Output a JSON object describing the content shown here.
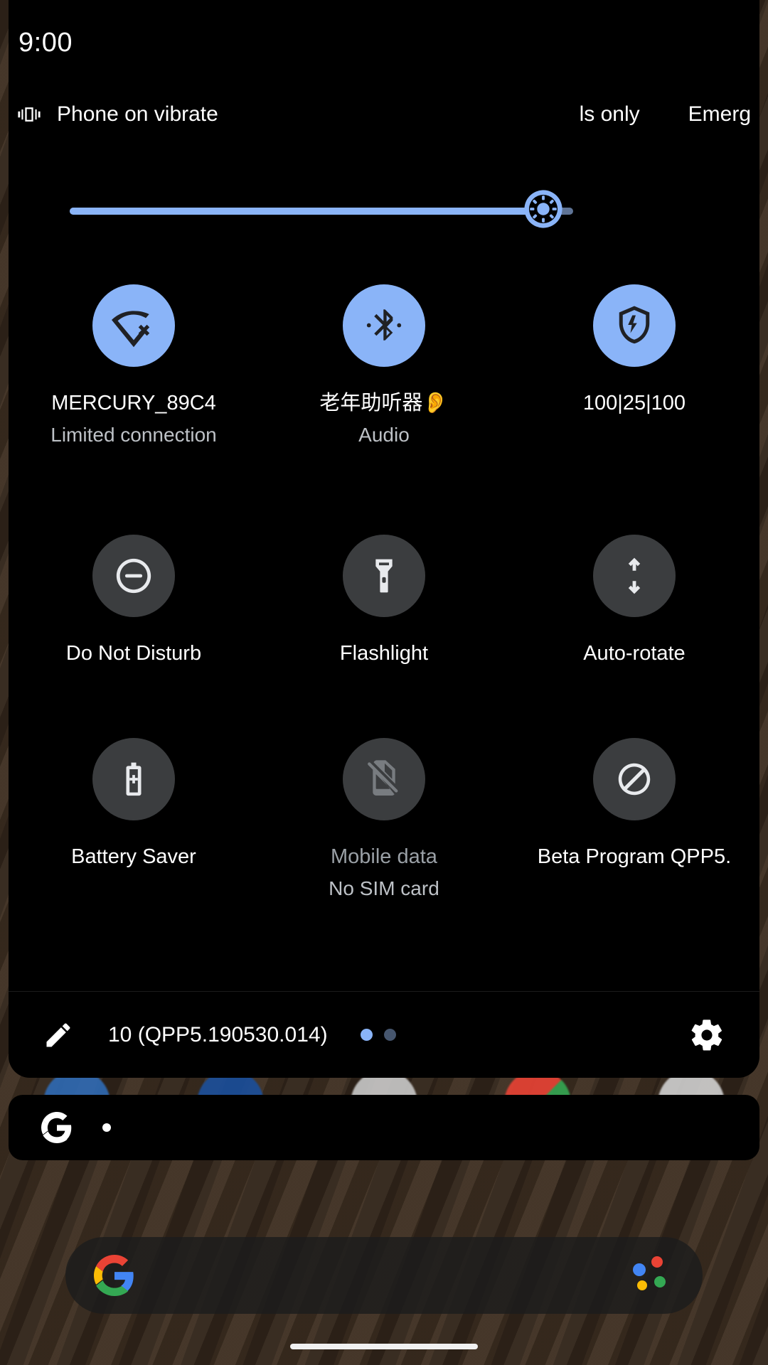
{
  "status_bar": {
    "clock": "9:00",
    "vibrate_icon": "vibrate-icon",
    "vibrate_text": "Phone on vibrate",
    "carrier_1": "ls only",
    "carrier_2": "Emerg"
  },
  "brightness": {
    "icon": "brightness-icon",
    "value": 94,
    "track_color": "#5f7496",
    "fill_color": "#8ab4f8"
  },
  "tiles": [
    {
      "name": "wifi",
      "icon": "wifi-off-icon",
      "label": "MERCURY_89C4",
      "sub": "Limited connection",
      "state": "on"
    },
    {
      "name": "bluetooth",
      "icon": "bluetooth-icon",
      "label": "老年助听器👂",
      "sub": "Audio",
      "state": "on"
    },
    {
      "name": "battery-share",
      "icon": "battery-share-icon",
      "label": "100|25|100",
      "sub": "",
      "state": "on"
    },
    {
      "name": "do-not-disturb",
      "icon": "do-not-disturb-icon",
      "label": "Do Not Disturb",
      "sub": "",
      "state": "off"
    },
    {
      "name": "flashlight",
      "icon": "flashlight-icon",
      "label": "Flashlight",
      "sub": "",
      "state": "off"
    },
    {
      "name": "auto-rotate",
      "icon": "auto-rotate-icon",
      "label": "Auto-rotate",
      "sub": "",
      "state": "off"
    },
    {
      "name": "battery-saver",
      "icon": "battery-saver-icon",
      "label": "Battery Saver",
      "sub": "",
      "state": "off"
    },
    {
      "name": "mobile-data",
      "icon": "no-sim-icon",
      "label": "Mobile data",
      "sub": "No SIM card",
      "state": "disabled"
    },
    {
      "name": "beta-program",
      "icon": "beta-program-icon",
      "label": "Beta Program QPP5.",
      "sub": "",
      "state": "off"
    }
  ],
  "footer": {
    "edit_icon": "pencil-icon",
    "build_text": "10 (QPP5.190530.014)",
    "page_dots": [
      {
        "state": "active"
      },
      {
        "state": "inactive"
      }
    ],
    "settings_icon": "gear-icon"
  },
  "dock": {
    "google_logo": "google-g-icon",
    "assistant_icon": "assistant-icon"
  },
  "qs_search": {
    "google_logo": "google-g-icon",
    "mic_dot": "dot-icon"
  },
  "colors": {
    "accent": "#8ab4f8",
    "tile_on_bg": "#8ab4f8",
    "tile_off_bg": "#3b3d3f",
    "panel_bg": "#000000",
    "text_primary": "#ffffff",
    "text_secondary": "#bdc1c6",
    "text_disabled": "#9aa0a6"
  }
}
